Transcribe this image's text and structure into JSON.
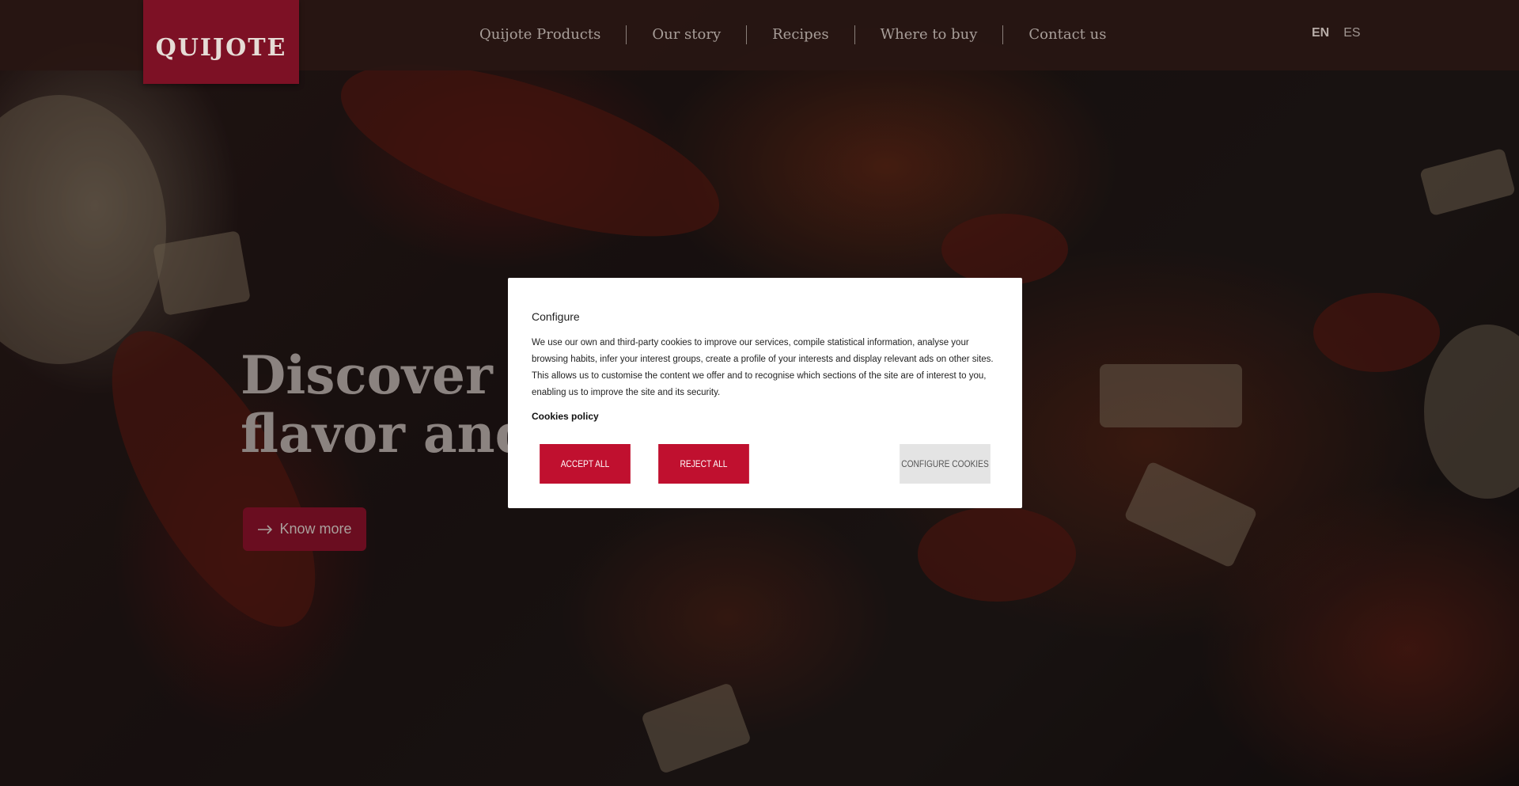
{
  "header": {
    "logo_text": "QUIJOTE",
    "nav": [
      {
        "label": "Quijote Products"
      },
      {
        "label": "Our story"
      },
      {
        "label": "Recipes"
      },
      {
        "label": "Where to buy"
      },
      {
        "label": "Contact us"
      }
    ],
    "languages": [
      {
        "label": "EN",
        "active": true
      },
      {
        "label": "ES",
        "active": false
      }
    ]
  },
  "hero": {
    "title": "Discover o\nflavor and",
    "cta_label": "Know more",
    "cta_icon": "arrow-right-icon"
  },
  "cookie_modal": {
    "title": "Configure",
    "body": "We use our own and third-party cookies to improve our services, compile statistical information, analyse your browsing habits, infer your interest groups, create a profile of your interests and display relevant ads on other sites. This allows us to customise the content we offer and to recognise which sections of the site are of interest to you, enabling us to improve the site and its security.",
    "policy_link": "Cookies policy",
    "accept_label": "Accept all",
    "reject_label": "Reject all",
    "configure_label": "Configure cookies"
  },
  "colors": {
    "brand": "#c0102f",
    "logo_bg": "#7d1125",
    "header_bg": "#28160f"
  }
}
